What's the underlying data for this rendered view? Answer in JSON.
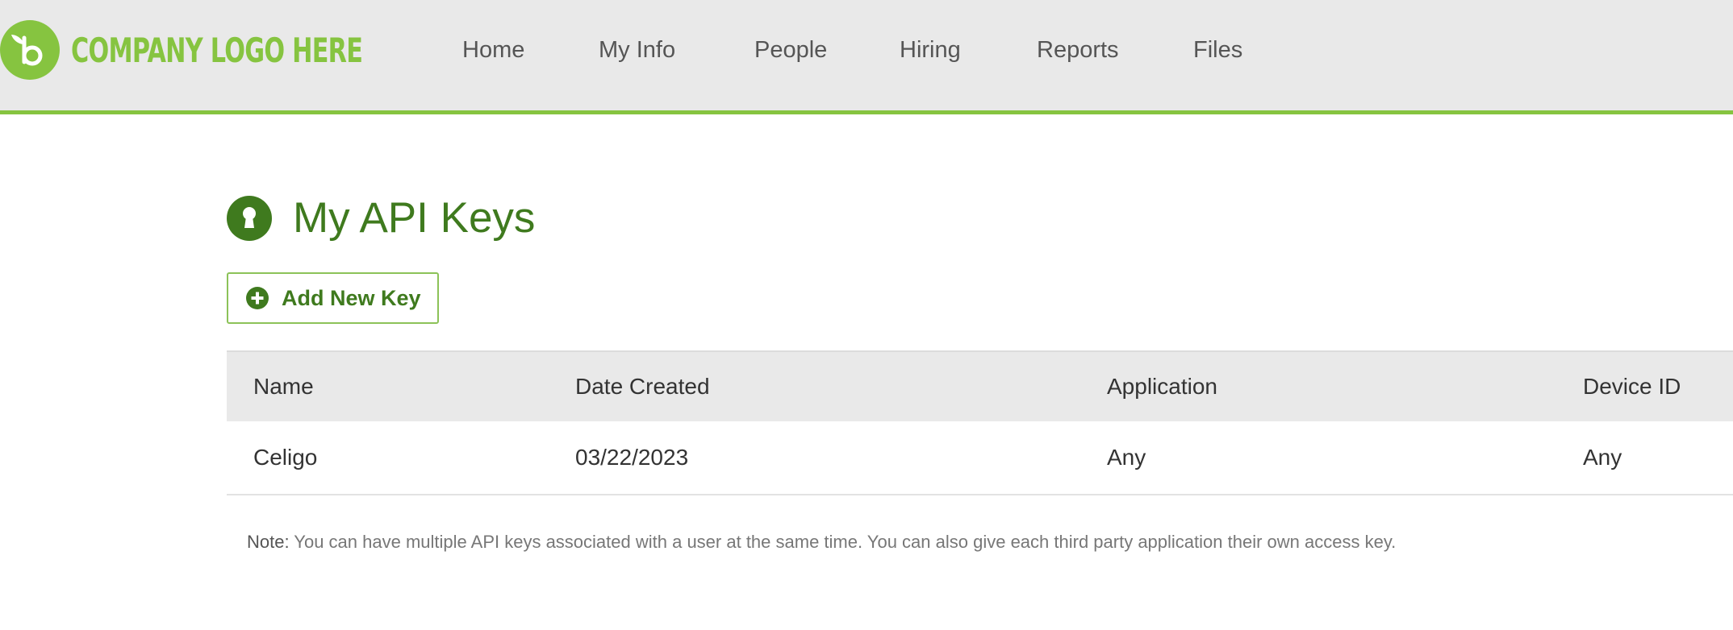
{
  "header": {
    "logo_text": "COMPANY LOGO HERE",
    "logo_icon": "bamboo-leaf-icon",
    "nav": [
      {
        "label": "Home"
      },
      {
        "label": "My Info"
      },
      {
        "label": "People"
      },
      {
        "label": "Hiring"
      },
      {
        "label": "Reports"
      },
      {
        "label": "Files"
      }
    ]
  },
  "page": {
    "title": "My API Keys",
    "title_icon": "keyhole-icon",
    "add_button_label": "Add New Key",
    "add_button_icon": "plus-circle-icon"
  },
  "table": {
    "columns": [
      "Name",
      "Date Created",
      "Application",
      "Device ID"
    ],
    "rows": [
      [
        "Celigo",
        "03/22/2023",
        "Any",
        "Any"
      ]
    ]
  },
  "note": {
    "label": "Note:",
    "text": " You can have multiple API keys associated with a user at the same time. You can also give each third party application their own access key."
  },
  "colors": {
    "brand_green": "#86c440",
    "title_green": "#3f7a1e",
    "header_bg": "#e9e9e9"
  }
}
